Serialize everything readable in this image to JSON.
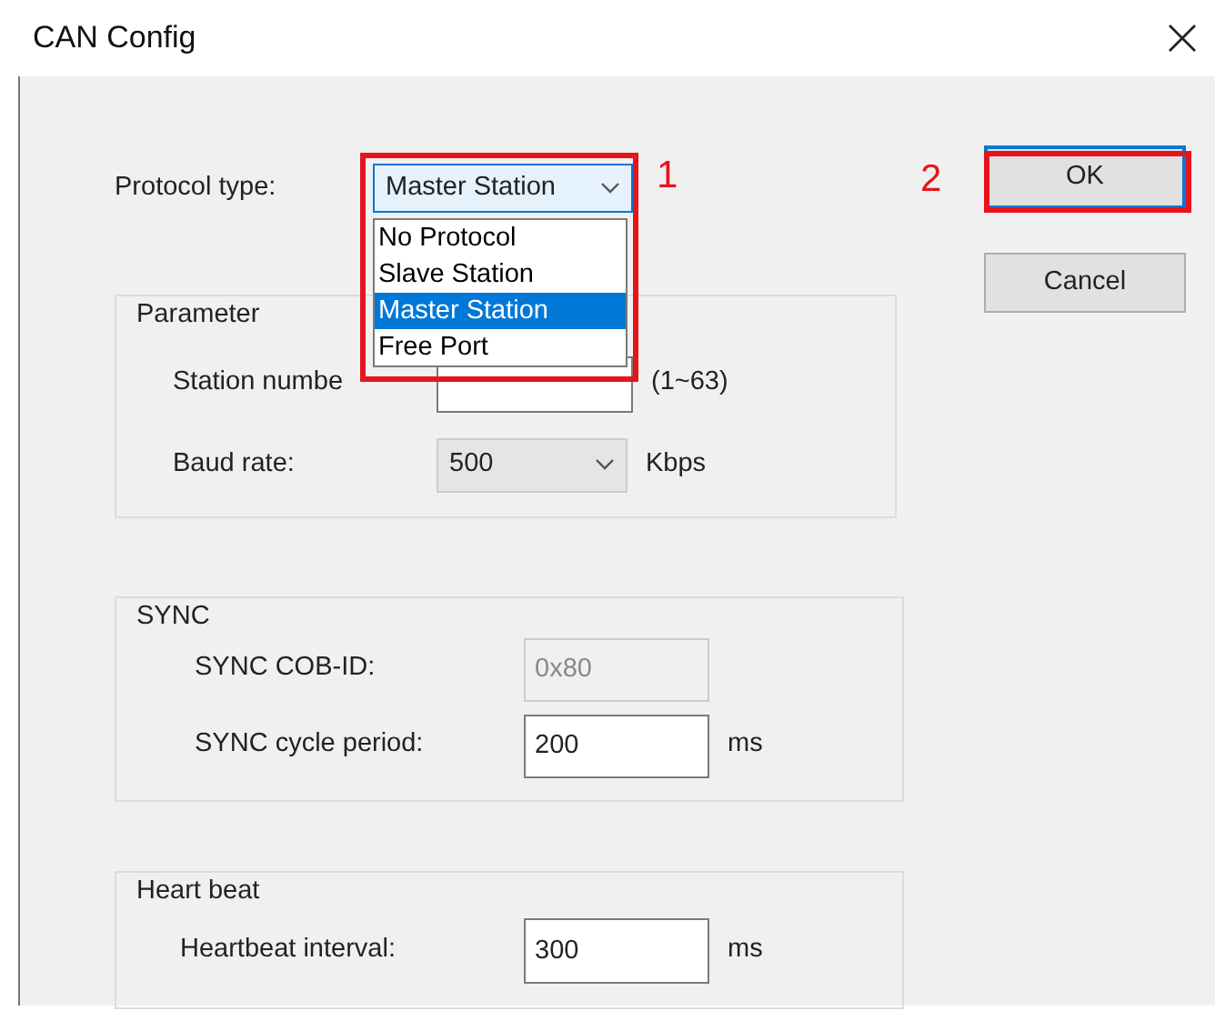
{
  "window": {
    "title": "CAN Config"
  },
  "protocol": {
    "label": "Protocol type:",
    "value": "Master Station",
    "open": true,
    "options": [
      {
        "label": "No Protocol",
        "selected": false
      },
      {
        "label": "Slave Station",
        "selected": false
      },
      {
        "label": "Master Station",
        "selected": true
      },
      {
        "label": "Free Port",
        "selected": false
      }
    ]
  },
  "parameter": {
    "title": "Parameter",
    "station_number": {
      "label": "Station numbe",
      "unit": "(1~63)"
    },
    "baud_rate": {
      "label": "Baud rate:",
      "value": "500",
      "unit": "Kbps"
    }
  },
  "sync": {
    "title": "SYNC",
    "cob_id": {
      "label": "SYNC COB-ID:",
      "value": "0x80",
      "disabled": true
    },
    "cycle_period": {
      "label": "SYNC cycle period:",
      "value": "200",
      "unit": "ms",
      "disabled": false
    }
  },
  "heartbeat": {
    "title": "Heart beat",
    "interval": {
      "label": "Heartbeat interval:",
      "value": "300",
      "unit": "ms",
      "disabled": false
    }
  },
  "buttons": [
    {
      "label": "OK",
      "default": true
    },
    {
      "label": "Cancel",
      "default": false
    }
  ],
  "annotations": [
    {
      "label": "1"
    },
    {
      "label": "2"
    }
  ]
}
